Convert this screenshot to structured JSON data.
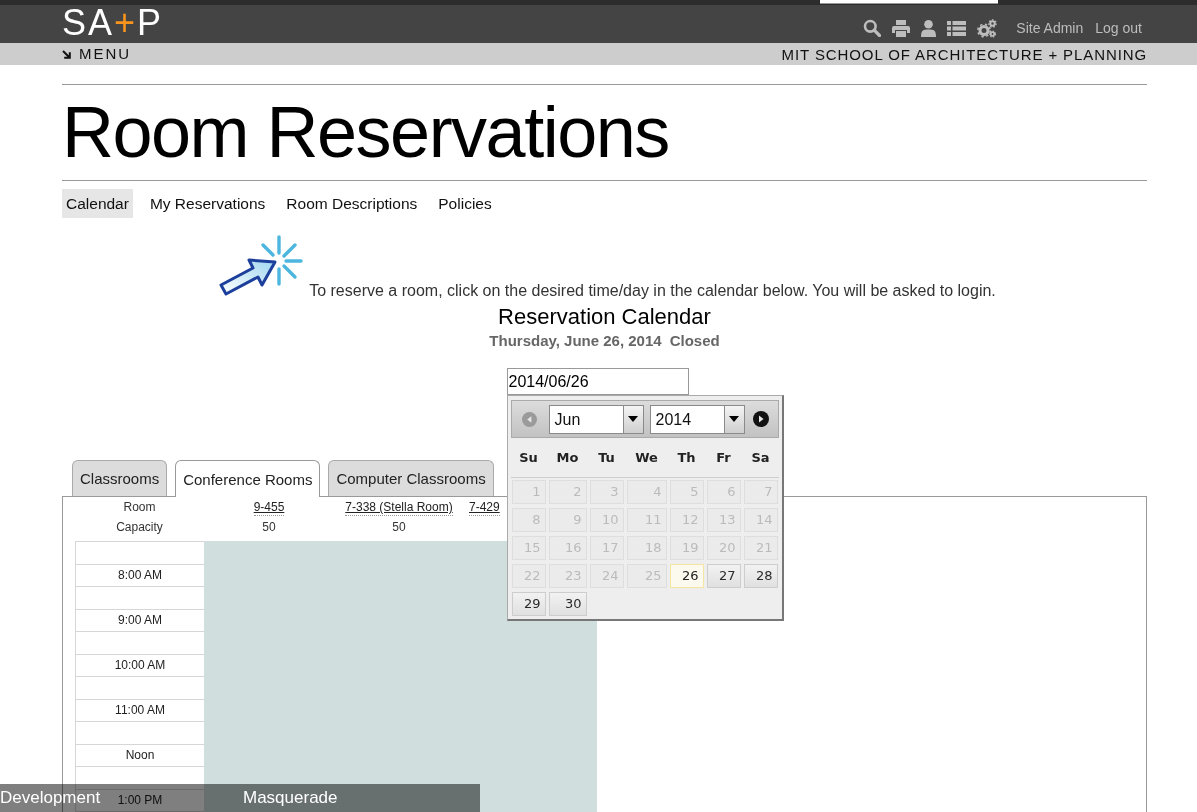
{
  "header": {
    "logo": [
      {
        "text": "SA",
        "color": "#ffffff"
      },
      {
        "text": "+",
        "color": "#f7941d"
      },
      {
        "text": "P",
        "color": "#ffffff"
      }
    ],
    "links": [
      "Site Admin",
      "Log out"
    ]
  },
  "menu_bar": {
    "menu_label": "MENU",
    "school_name": "MIT SCHOOL OF ARCHITECTURE + PLANNING"
  },
  "page_title": "Room Reservations",
  "nav_tabs": [
    {
      "label": "Calendar",
      "selected": true
    },
    {
      "label": "My Reservations",
      "selected": false
    },
    {
      "label": "Room Descriptions",
      "selected": false
    },
    {
      "label": "Policies",
      "selected": false
    }
  ],
  "instructions": "To reserve a room, click on the desired time/day in the calendar below. You will be asked to login.",
  "calendar_title": "Reservation Calendar",
  "date_heading": {
    "date": "Thursday, June 26, 2014",
    "status": "Closed"
  },
  "date_field": {
    "value": "2014/06/26"
  },
  "datepicker": {
    "prev": {
      "disabled": true
    },
    "next": {
      "disabled": false
    },
    "month": "Jun",
    "year": "2014",
    "weekdays": [
      "Su",
      "Mo",
      "Tu",
      "We",
      "Th",
      "Fr",
      "Sa"
    ],
    "days": [
      {
        "label": "1",
        "disabled": true,
        "selected": false
      },
      {
        "label": "2",
        "disabled": true,
        "selected": false
      },
      {
        "label": "3",
        "disabled": true,
        "selected": false
      },
      {
        "label": "4",
        "disabled": true,
        "selected": false
      },
      {
        "label": "5",
        "disabled": true,
        "selected": false
      },
      {
        "label": "6",
        "disabled": true,
        "selected": false
      },
      {
        "label": "7",
        "disabled": true,
        "selected": false
      },
      {
        "label": "8",
        "disabled": true,
        "selected": false
      },
      {
        "label": "9",
        "disabled": true,
        "selected": false
      },
      {
        "label": "10",
        "disabled": true,
        "selected": false
      },
      {
        "label": "11",
        "disabled": true,
        "selected": false
      },
      {
        "label": "12",
        "disabled": true,
        "selected": false
      },
      {
        "label": "13",
        "disabled": true,
        "selected": false
      },
      {
        "label": "14",
        "disabled": true,
        "selected": false
      },
      {
        "label": "15",
        "disabled": true,
        "selected": false
      },
      {
        "label": "16",
        "disabled": true,
        "selected": false
      },
      {
        "label": "17",
        "disabled": true,
        "selected": false
      },
      {
        "label": "18",
        "disabled": true,
        "selected": false
      },
      {
        "label": "19",
        "disabled": true,
        "selected": false
      },
      {
        "label": "20",
        "disabled": true,
        "selected": false
      },
      {
        "label": "21",
        "disabled": true,
        "selected": false
      },
      {
        "label": "22",
        "disabled": true,
        "selected": false
      },
      {
        "label": "23",
        "disabled": true,
        "selected": false
      },
      {
        "label": "24",
        "disabled": true,
        "selected": false
      },
      {
        "label": "25",
        "disabled": true,
        "selected": false
      },
      {
        "label": "26",
        "disabled": false,
        "selected": true
      },
      {
        "label": "27",
        "disabled": false,
        "selected": false
      },
      {
        "label": "28",
        "disabled": false,
        "selected": false
      },
      {
        "label": "29",
        "disabled": false,
        "selected": false
      },
      {
        "label": "30",
        "disabled": false,
        "selected": false
      }
    ]
  },
  "room_tabs": [
    {
      "label": "Classrooms",
      "selected": false
    },
    {
      "label": "Conference Rooms",
      "selected": true
    },
    {
      "label": "Computer Classrooms",
      "selected": false
    }
  ],
  "schedule": {
    "room_label": "Room",
    "capacity_label": "Capacity",
    "rooms": [
      {
        "name": "9-455",
        "capacity": "50"
      },
      {
        "name": "7-338 (Stella Room)",
        "capacity": "50"
      },
      {
        "name": "7-429"
      }
    ],
    "times": [
      "8:00 AM",
      "9:00 AM",
      "10:00 AM",
      "11:00 AM",
      "Noon",
      "1:00 PM"
    ]
  },
  "dev_bar": [
    "Development",
    "Masquerade"
  ]
}
